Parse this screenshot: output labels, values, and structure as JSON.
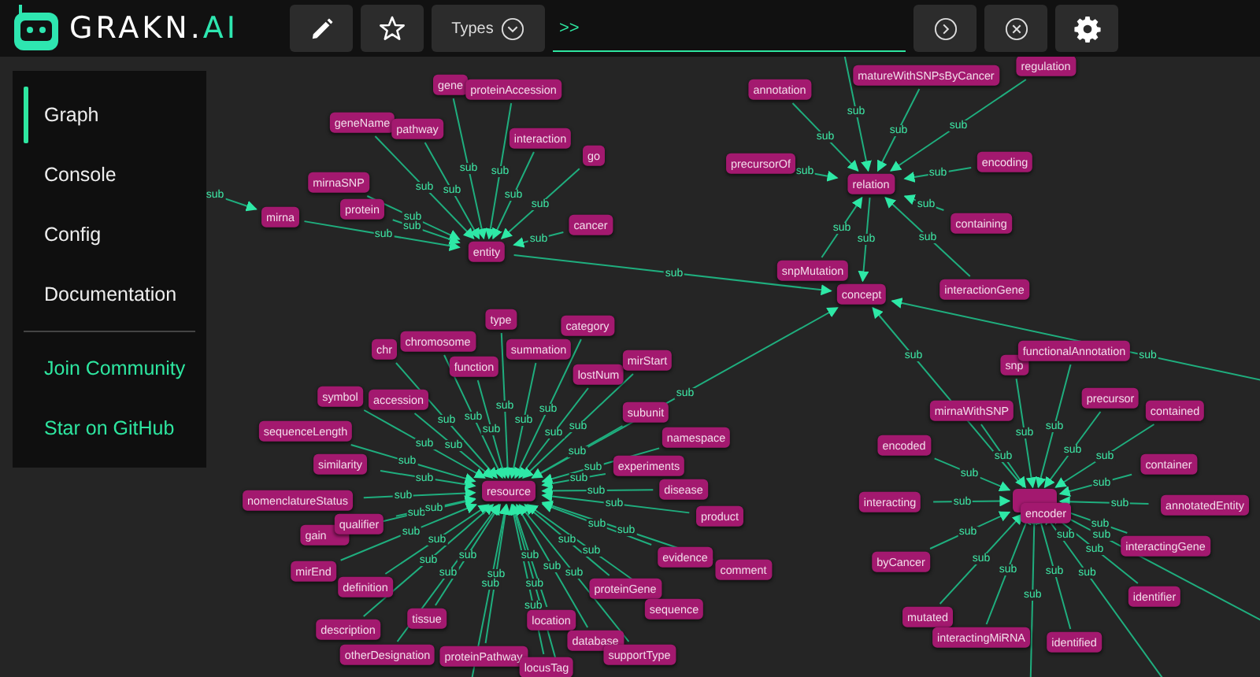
{
  "logo": {
    "name": "GRAKN.",
    "suffix": "AI"
  },
  "toolbar": {
    "types_label": "Types",
    "prompt": ">>"
  },
  "sidebar": {
    "items": [
      {
        "label": "Graph",
        "selected": true
      },
      {
        "label": "Console",
        "selected": false
      },
      {
        "label": "Config",
        "selected": false
      },
      {
        "label": "Documentation",
        "selected": false
      }
    ],
    "links": [
      "Join Community",
      "Star on GitHub"
    ]
  },
  "graph": {
    "label": "concept",
    "children": [
      {
        "label": "entity",
        "edge": "sub",
        "children": [
          {
            "label": "gene",
            "edge": "sub"
          },
          {
            "label": "proteinAccession",
            "edge": "sub"
          },
          {
            "label": "geneName",
            "edge": "sub"
          },
          {
            "label": "pathway",
            "edge": "sub"
          },
          {
            "label": "interaction",
            "edge": "sub"
          },
          {
            "label": "go",
            "edge": "sub"
          },
          {
            "label": "mirnaSNP",
            "edge": "sub"
          },
          {
            "label": "mirna",
            "edge": "sub",
            "children": [
              {
                "edge": "sub"
              }
            ]
          },
          {
            "label": "protein",
            "edge": "sub"
          },
          {
            "label": "cancer",
            "edge": "sub"
          }
        ]
      },
      {
        "label": "relation",
        "edge": "sub",
        "children": [
          {
            "label": "annotation",
            "edge": "sub"
          },
          {
            "edge": "sub"
          },
          {
            "label": "matureWithSNPsByCancer",
            "edge": "sub"
          },
          {
            "label": "regulation",
            "edge": "sub"
          },
          {
            "label": "precursorOf",
            "edge": "sub"
          },
          {
            "label": "encoding",
            "edge": "sub"
          },
          {
            "label": "containing",
            "edge": "sub"
          },
          {
            "label": "snpMutation",
            "edge": "sub"
          },
          {
            "label": "interactionGene",
            "edge": "sub"
          }
        ]
      },
      {
        "label": "resource",
        "edge": "sub",
        "children": [
          {
            "label": "type",
            "edge": "sub"
          },
          {
            "label": "category",
            "edge": "sub"
          },
          {
            "label": "chr",
            "edge": "sub"
          },
          {
            "label": "chromosome",
            "edge": "sub"
          },
          {
            "label": "summation",
            "edge": "sub"
          },
          {
            "label": "function",
            "edge": "sub"
          },
          {
            "label": "lostNum",
            "edge": "sub"
          },
          {
            "label": "mirStart",
            "edge": "sub"
          },
          {
            "label": "symbol",
            "edge": "sub"
          },
          {
            "label": "accession",
            "edge": "sub"
          },
          {
            "label": "subunit",
            "edge": "sub"
          },
          {
            "label": "sequenceLength",
            "edge": "sub"
          },
          {
            "label": "namespace",
            "edge": "sub"
          },
          {
            "label": "similarity",
            "edge": "sub"
          },
          {
            "label": "experiments",
            "edge": "sub"
          },
          {
            "label": "nomenclatureStatus",
            "edge": "sub"
          },
          {
            "label": "disease",
            "edge": "sub"
          },
          {
            "label": "gain",
            "edge": "sub"
          },
          {
            "label": "qualifier",
            "edge": "sub"
          },
          {
            "label": "product",
            "edge": "sub"
          },
          {
            "label": "mirEnd",
            "edge": "sub"
          },
          {
            "label": "evidence",
            "edge": "sub"
          },
          {
            "label": "comment",
            "edge": "sub"
          },
          {
            "label": "definition",
            "edge": "sub"
          },
          {
            "label": "proteinGene",
            "edge": "sub"
          },
          {
            "label": "description",
            "edge": "sub"
          },
          {
            "label": "tissue",
            "edge": "sub"
          },
          {
            "label": "location",
            "edge": "sub"
          },
          {
            "label": "database",
            "edge": "sub"
          },
          {
            "label": "sequence",
            "edge": "sub"
          },
          {
            "label": "otherDesignation",
            "edge": "sub"
          },
          {
            "label": "proteinPathway",
            "edge": "sub"
          },
          {
            "label": "locusTag",
            "edge": "sub"
          },
          {
            "label": "supportType",
            "edge": "sub"
          },
          {
            "edge": "sub"
          },
          {
            "edge": "sub"
          }
        ]
      },
      {
        "edge": "sub",
        "children": [
          {
            "label": "snp",
            "edge": "sub"
          },
          {
            "label": "functionalAnnotation",
            "edge": "sub"
          },
          {
            "label": "mirnaWithSNP",
            "edge": "sub"
          },
          {
            "label": "precursor",
            "edge": "sub"
          },
          {
            "label": "contained",
            "edge": "sub"
          },
          {
            "label": "encoded",
            "edge": "sub"
          },
          {
            "label": "container",
            "edge": "sub"
          },
          {
            "label": "interacting",
            "edge": "sub"
          },
          {
            "label": "encoder",
            "edge": "sub"
          },
          {
            "label": "annotatedEntity",
            "edge": "sub"
          },
          {
            "label": "byCancer",
            "edge": "sub"
          },
          {
            "label": "interactingGene",
            "edge": "sub"
          },
          {
            "label": "identifier",
            "edge": "sub"
          },
          {
            "label": "mutated",
            "edge": "sub"
          },
          {
            "label": "interactingMiRNA",
            "edge": "sub"
          },
          {
            "label": "identified",
            "edge": "sub"
          },
          {
            "edge": "sub"
          },
          {
            "edge": "sub"
          },
          {
            "edge": "sub"
          }
        ]
      },
      {
        "edge": "sub"
      }
    ]
  }
}
